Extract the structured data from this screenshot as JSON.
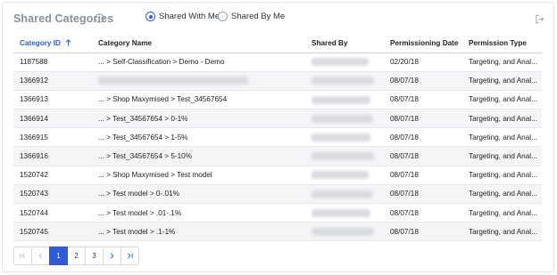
{
  "header": {
    "title": "Shared Categories",
    "radios": [
      {
        "label": "Shared With Me",
        "checked": true
      },
      {
        "label": "Shared By Me",
        "checked": false
      }
    ]
  },
  "table": {
    "columns": [
      "Category ID",
      "Category Name",
      "Shared By",
      "Permissioning Date",
      "Permission Type"
    ],
    "sort_column": "Category ID",
    "sort_direction": "ascending",
    "rows": [
      {
        "id": "1187588",
        "name": "... > Self-Classification > Demo - Demo",
        "date": "02/20/18",
        "type": "Targeting, and Anal..."
      },
      {
        "id": "1366912",
        "name": "",
        "date": "08/07/18",
        "type": "Targeting, and Anal..."
      },
      {
        "id": "1366913",
        "name": "... > Shop Maxymised > Test_34567654",
        "date": "08/07/18",
        "type": "Targeting, and Anal..."
      },
      {
        "id": "1366914",
        "name": "... > Test_34567654 > 0-1%",
        "date": "08/07/18",
        "type": "Targeting, and Anal..."
      },
      {
        "id": "1366915",
        "name": "... > Test_34567654 > 1-5%",
        "date": "08/07/18",
        "type": "Targeting, and Anal..."
      },
      {
        "id": "1366916",
        "name": "... > Test_34567654 > 5-10%",
        "date": "08/07/18",
        "type": "Targeting, and Anal..."
      },
      {
        "id": "1520742",
        "name": "... > Shop Maxymised > Test model",
        "date": "08/07/18",
        "type": "Targeting, and Anal..."
      },
      {
        "id": "1520743",
        "name": "... > Test model > 0-.01%",
        "date": "08/07/18",
        "type": "Targeting, and Anal..."
      },
      {
        "id": "1520744",
        "name": "... > Test model > .01-.1%",
        "date": "08/07/18",
        "type": "Targeting, and Anal..."
      },
      {
        "id": "1520745",
        "name": "... > Test model > .1-1%",
        "date": "08/07/18",
        "type": "Targeting, and Anal..."
      }
    ]
  },
  "pagination": {
    "pages": [
      "1",
      "2",
      "3"
    ],
    "current": "1"
  },
  "colors": {
    "accent": "#2f5bd6",
    "title": "#8a8f99",
    "row_alt": "#f4f5f7"
  }
}
